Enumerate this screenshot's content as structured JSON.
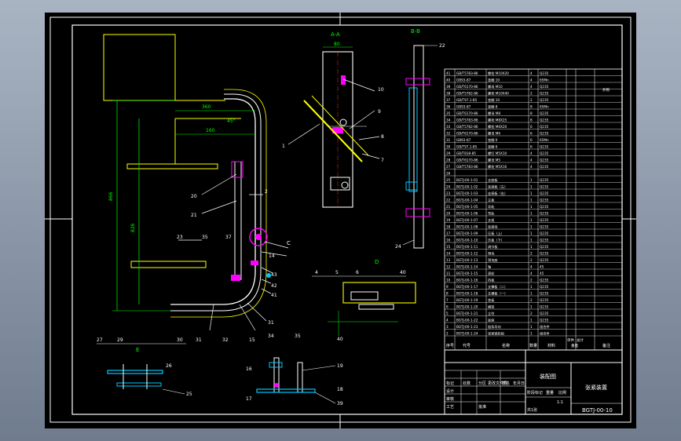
{
  "colors": {
    "background": "#000000",
    "frame": "#ffffff",
    "part": "#ffff00",
    "dimension": "#00ff00",
    "leader": "#ffffff",
    "highlight": "#ff00ff",
    "centerline": "#ff3030",
    "component": "#00c8ff"
  },
  "section_labels": {
    "a_a": "A-A",
    "b_b": "B-B",
    "c_c": "C-C",
    "d": "D",
    "e": "E",
    "c_marker": "C"
  },
  "callouts": {
    "left": [
      "20",
      "21",
      "23",
      "35",
      "37",
      "2",
      "14",
      "43",
      "42",
      "41",
      "15",
      "32",
      "31"
    ],
    "bottom": [
      "27",
      "29",
      "30",
      "31",
      "26",
      "25"
    ],
    "section_view": [
      "1",
      "10",
      "9",
      "8",
      "7"
    ],
    "right_view": [
      "22",
      "24"
    ],
    "detail_d": [
      "4",
      "5",
      "6",
      "40"
    ],
    "detail_bottom": [
      "34",
      "35",
      "40",
      "16",
      "17",
      "19",
      "18",
      "39"
    ]
  },
  "dimensions": {
    "left_height": "866",
    "left_lower": "826",
    "top_1": "360",
    "top_2": "160",
    "b_width": "80",
    "angle": "45°"
  },
  "bom_rows": [
    [
      "41",
      "GB/T5783-86",
      "螺栓 M10X20",
      "4",
      "Q235"
    ],
    [
      "40",
      "GB93-87",
      "垫圈 10",
      "4",
      "65Mn"
    ],
    [
      "39",
      "GB/T6170-86",
      "螺母 M10",
      "4",
      "Q235"
    ],
    [
      "38",
      "GB/T5782-86",
      "螺栓 M10X40",
      "2",
      "Q235"
    ],
    [
      "37",
      "GB/T97.1-85",
      "垫圈 10",
      "2",
      "Q235"
    ],
    [
      "36",
      "GB93-87",
      "垫圈 8",
      "8",
      "65Mn"
    ],
    [
      "35",
      "GB/T6170-86",
      "螺母 M8",
      "8",
      "Q235"
    ],
    [
      "34",
      "GB/T5783-86",
      "螺栓 M8X25",
      "8",
      "Q235"
    ],
    [
      "33",
      "GB/T5782-86",
      "螺栓 M6X20",
      "6",
      "Q235"
    ],
    [
      "32",
      "GB/T6170-86",
      "螺母 M6",
      "6",
      "Q235"
    ],
    [
      "31",
      "GB93-87",
      "垫圈 6",
      "6",
      "65Mn"
    ],
    [
      "30",
      "GB/T97.1-85",
      "垫圈 6",
      "6",
      "Q235"
    ],
    [
      "29",
      "GB/T818-85",
      "螺钉 M5X10",
      "4",
      "Q235"
    ],
    [
      "28",
      "GB/T6170-86",
      "螺母 M5",
      "4",
      "Q235"
    ],
    [
      "27",
      "GB/T5783-86",
      "螺栓 M5X16",
      "4",
      "Q235"
    ],
    [
      "26",
      "",
      "",
      "",
      ""
    ],
    [
      "25",
      "BGTJ-00-1-01",
      "支座板",
      "1",
      "Q235"
    ],
    [
      "24",
      "BGTJ-00-1-02",
      "连接板（左）",
      "1",
      "Q235"
    ],
    [
      "23",
      "BGTJ-00-1-03",
      "连接板（右）",
      "1",
      "Q235"
    ],
    [
      "22",
      "BGTJ-00-1-04",
      "立板",
      "1",
      "Q235"
    ],
    [
      "21",
      "BGTJ-00-1-05",
      "导轨",
      "1",
      "Q235"
    ],
    [
      "20",
      "BGTJ-00-1-06",
      "弯轨",
      "1",
      "Q235"
    ],
    [
      "19",
      "BGTJ-00-1-07",
      "支架",
      "1",
      "Q235"
    ],
    [
      "18",
      "BGTJ-00-1-08",
      "连接块",
      "1",
      "Q235"
    ],
    [
      "17",
      "BGTJ-00-1-09",
      "压板（上）",
      "1",
      "Q235"
    ],
    [
      "16",
      "BGTJ-00-1-10",
      "压板（下）",
      "1",
      "Q235"
    ],
    [
      "15",
      "BGTJ-00-1-11",
      "调节板",
      "1",
      "Q235"
    ],
    [
      "14",
      "BGTJ-00-1-12",
      "滑块",
      "2",
      "Q235"
    ],
    [
      "13",
      "BGTJ-00-1-13",
      "滑块座",
      "2",
      "Q235"
    ],
    [
      "12",
      "BGTJ-00-1-14",
      "轴",
      "4",
      "45"
    ],
    [
      "11",
      "BGTJ-00-1-15",
      "滚轮",
      "4",
      "45"
    ],
    [
      "10",
      "BGTJ-00-1-16",
      "挡板",
      "2",
      "Q235"
    ],
    [
      "9",
      "BGTJ-00-1-17",
      "支撑板（二）",
      "1",
      "Q235"
    ],
    [
      "8",
      "BGTJ-00-1-18",
      "支撑板（一）",
      "1",
      "Q235"
    ],
    [
      "7",
      "BGTJ-00-1-19",
      "垫板",
      "2",
      "Q235"
    ],
    [
      "6",
      "BGTJ-00-1-20",
      "横梁",
      "1",
      "Q235"
    ],
    [
      "5",
      "BGTJ-00-1-21",
      "立柱",
      "2",
      "Q235"
    ],
    [
      "4",
      "BGTJ-00-1-22",
      "底座",
      "1",
      "Q235"
    ],
    [
      "3",
      "BGTJ-00-1-23",
      "链条导向",
      "1",
      "组合件"
    ],
    [
      "2",
      "BGTJ-00-1-24",
      "张紧链轮组",
      "1",
      "组合件"
    ]
  ],
  "bom_note": "外购",
  "bom_header": {
    "seq": "序号",
    "code": "代号",
    "name": "名称",
    "qty": "数量",
    "material": "材料",
    "unit_weight": "单件",
    "total_weight": "总计",
    "weight": "重量",
    "remark": "备注"
  },
  "title_block": {
    "part_name": "张紧装置",
    "material_cell": "装配图",
    "drawing_no": "BGTJ-00-10",
    "scale": "1:1",
    "sheet_count": "共1张",
    "row_labels": [
      "标记",
      "处数",
      "分区",
      "更改文件号",
      "签名",
      "年月日"
    ],
    "sign_labels": [
      "设计",
      "审核",
      "工艺",
      "批准"
    ],
    "stage_labels": [
      "阶段标记",
      "重量",
      "比例"
    ]
  }
}
